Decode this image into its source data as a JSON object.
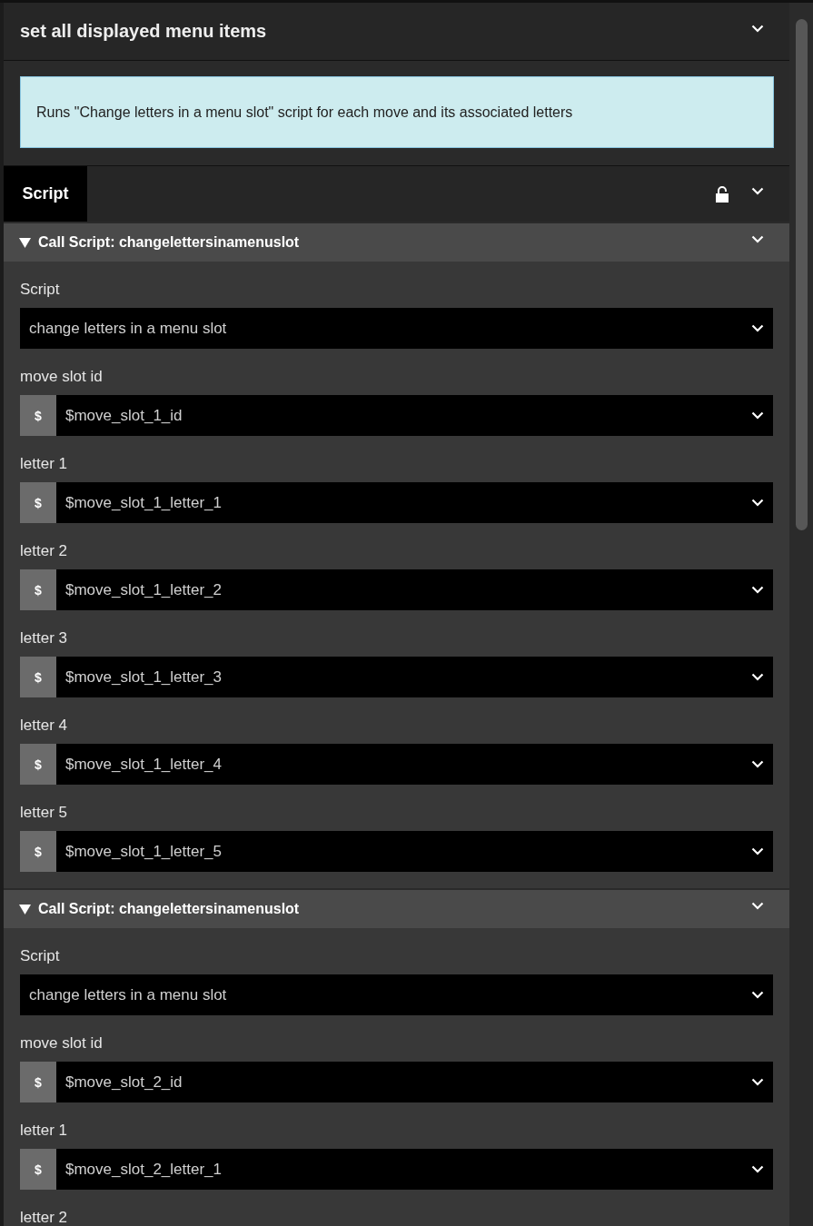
{
  "panel": {
    "title": "set all displayed menu items",
    "expanded": true
  },
  "description": "Runs \"Change letters in a menu slot\" script for each move and its associated letters",
  "tabs": [
    {
      "label": "Script",
      "selected": true
    }
  ],
  "script_locked": false,
  "calls": [
    {
      "title": "Call Script: changelettersinamenuslot",
      "expanded": true,
      "fields": [
        {
          "label": "Script",
          "kind": "select",
          "value": "change letters in a menu slot"
        },
        {
          "label": "move slot id",
          "kind": "variable",
          "prefix": "$",
          "value": "$move_slot_1_id"
        },
        {
          "label": "letter 1",
          "kind": "variable",
          "prefix": "$",
          "value": "$move_slot_1_letter_1"
        },
        {
          "label": "letter 2",
          "kind": "variable",
          "prefix": "$",
          "value": "$move_slot_1_letter_2"
        },
        {
          "label": "letter 3",
          "kind": "variable",
          "prefix": "$",
          "value": "$move_slot_1_letter_3"
        },
        {
          "label": "letter 4",
          "kind": "variable",
          "prefix": "$",
          "value": "$move_slot_1_letter_4"
        },
        {
          "label": "letter 5",
          "kind": "variable",
          "prefix": "$",
          "value": "$move_slot_1_letter_5"
        }
      ]
    },
    {
      "title": "Call Script: changelettersinamenuslot",
      "expanded": true,
      "fields": [
        {
          "label": "Script",
          "kind": "select",
          "value": "change letters in a menu slot"
        },
        {
          "label": "move slot id",
          "kind": "variable",
          "prefix": "$",
          "value": "$move_slot_2_id"
        },
        {
          "label": "letter 1",
          "kind": "variable",
          "prefix": "$",
          "value": "$move_slot_2_letter_1"
        },
        {
          "label": "letter 2",
          "kind": "cut"
        }
      ]
    }
  ]
}
